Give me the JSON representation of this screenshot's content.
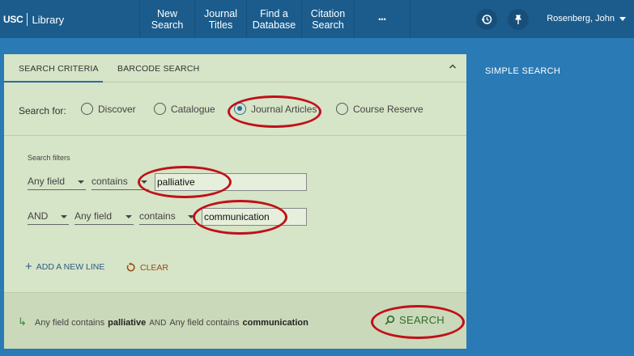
{
  "header": {
    "logo_org": "USC",
    "logo_name": "Library",
    "nav": [
      "New\nSearch",
      "Journal\nTitles",
      "Find a\nDatabase",
      "Citation\nSearch",
      "•••"
    ],
    "user_name": "Rosenberg, John"
  },
  "panel": {
    "tabs": [
      "SEARCH CRITERIA",
      "BARCODE SEARCH"
    ],
    "search_for_label": "Search for:",
    "scopes": [
      "Discover",
      "Catalogue",
      "Journal Articles",
      "Course Reserve"
    ],
    "selected_scope": "Journal Articles",
    "filters_title": "Search filters",
    "row1": {
      "field": "Any field",
      "operator": "contains",
      "value": "palliative"
    },
    "row2": {
      "boolean": "AND",
      "field": "Any field",
      "operator": "contains",
      "value": "communication"
    },
    "add_line_label": "ADD A NEW LINE",
    "clear_label": "CLEAR",
    "summary": {
      "prefix1": "Any field contains",
      "term1": "palliative",
      "joiner": "AND",
      "prefix2": "Any field contains",
      "term2": "communication"
    },
    "search_label": "SEARCH"
  },
  "side": {
    "title": "SIMPLE SEARCH"
  },
  "colors": {
    "header": "#1b5c8c",
    "background": "#2a7ab5",
    "panel": "#d6e4c7",
    "highlight_ring": "#c0101a",
    "search_green": "#2f6e2a"
  }
}
